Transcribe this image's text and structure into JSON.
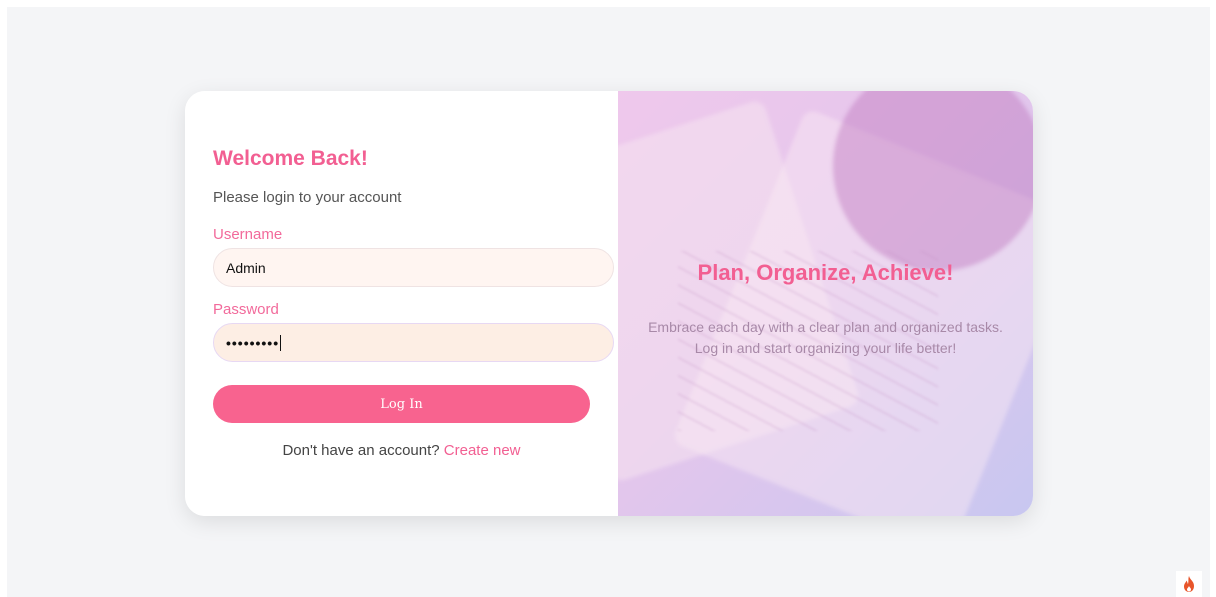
{
  "login": {
    "title": "Welcome Back!",
    "subtitle": "Please login to your account",
    "username_label": "Username",
    "username_value": "Admin",
    "password_label": "Password",
    "password_value": "•••••••••",
    "submit_label": "Log In",
    "signup_prompt": "Don't have an account?",
    "signup_link": "Create new"
  },
  "hero": {
    "title": "Plan, Organize, Achieve!",
    "text": "Embrace each day with a clear plan and organized tasks. Log in and start organizing your life better!"
  },
  "icons": {
    "corner": "flame-icon"
  },
  "colors": {
    "accent": "#f25f92",
    "button": "#f8638f",
    "background": "#f4f5f7"
  }
}
